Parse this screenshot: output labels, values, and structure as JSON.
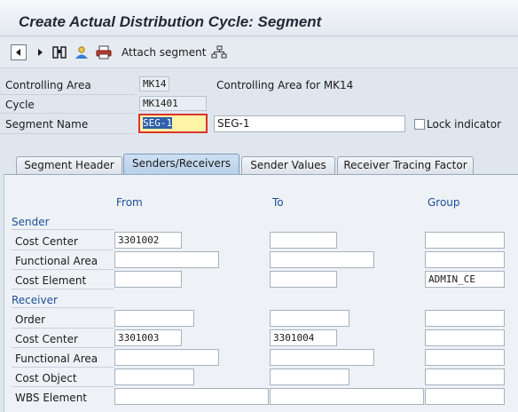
{
  "window": {
    "title": "Create Actual Distribution Cycle: Segment"
  },
  "toolbar": {
    "attach_label": "Attach segment",
    "icons": [
      "back-arrow-icon",
      "forward-arrow-icon",
      "binoculars-icon",
      "person-icon",
      "printer-icon",
      "hierarchy-icon"
    ]
  },
  "header": {
    "controlling_area": {
      "label": "Controlling Area",
      "value": "MK14",
      "description": "Controlling Area for MK14"
    },
    "cycle": {
      "label": "Cycle",
      "value": "MK1401"
    },
    "segment_name": {
      "label": "Segment Name",
      "value": "SEG-1",
      "description": "SEG-1"
    },
    "lock_indicator": {
      "label": "Lock indicator",
      "checked": false
    }
  },
  "tabs": [
    {
      "label": "Segment Header",
      "active": false
    },
    {
      "label": "Senders/Receivers",
      "active": true
    },
    {
      "label": "Sender Values",
      "active": false
    },
    {
      "label": "Receiver Tracing Factor",
      "active": false
    }
  ],
  "grid": {
    "columns": {
      "from": "From",
      "to": "To",
      "group": "Group"
    },
    "sender_title": "Sender",
    "receiver_title": "Receiver",
    "sender_rows": [
      {
        "label": "Cost Center",
        "from": "3301002",
        "to": "",
        "group": ""
      },
      {
        "label": "Functional Area",
        "from": "",
        "to": "",
        "group": ""
      },
      {
        "label": "Cost Element",
        "from": "",
        "to": "",
        "group": "ADMIN_CE"
      }
    ],
    "receiver_rows": [
      {
        "label": "Order",
        "from": "",
        "to": "",
        "group": ""
      },
      {
        "label": "Cost Center",
        "from": "3301003",
        "to": "3301004",
        "group": ""
      },
      {
        "label": "Functional Area",
        "from": "",
        "to": "",
        "group": ""
      },
      {
        "label": "Cost Object",
        "from": "",
        "to": "",
        "group": ""
      },
      {
        "label": "WBS Element",
        "from": "",
        "to": "",
        "group": ""
      }
    ]
  },
  "colors": {
    "section_blue": "#1f4e9a",
    "active_tab": "#b8d0ea",
    "focus_outline": "#d9352b",
    "focus_fill": "#fff3a6"
  }
}
